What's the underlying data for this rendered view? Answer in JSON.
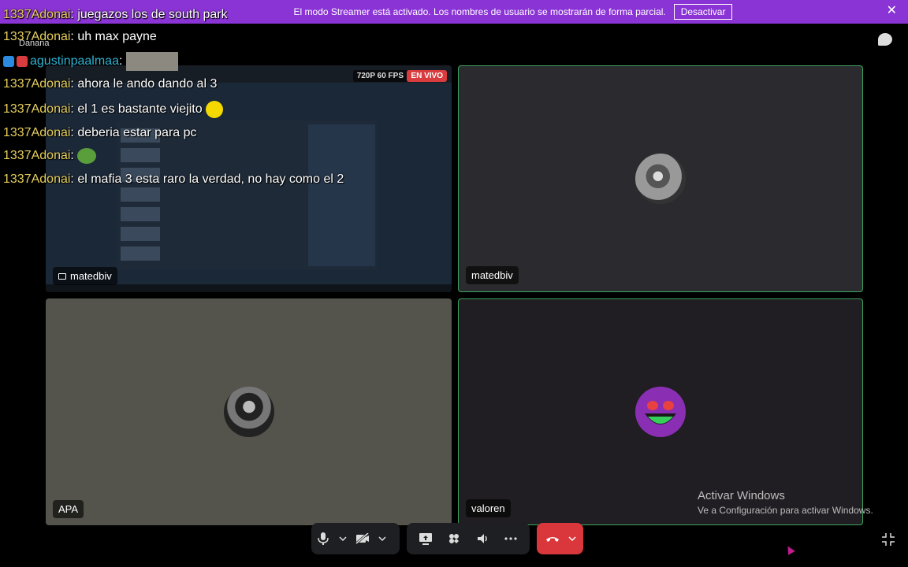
{
  "banner": {
    "message": "El modo Streamer está activado. Los nombres de usuario se mostrarán de forma parcial.",
    "button": "Desactivar",
    "close": "✕"
  },
  "chat": {
    "messages": [
      {
        "user": "1337Adonai",
        "text": ": juegazos los de south park"
      },
      {
        "user": "1337Adonai",
        "text": ": uh max payne"
      },
      {
        "user": "agustinpaalmaa",
        "text": ":"
      },
      {
        "user": "1337Adonai",
        "text": ": ahora le ando dando al 3"
      },
      {
        "user": "1337Adonai",
        "text": ": el 1 es bastante viejito"
      },
      {
        "user": "1337Adonai",
        "text": ": deberia estar para pc"
      },
      {
        "user": "1337Adonai",
        "text": ":"
      },
      {
        "user": "1337Adonai",
        "text": ": el mafia 3 esta raro la verdad, no hay como el 2"
      }
    ],
    "partial_name": "Danana"
  },
  "tiles": [
    {
      "name": "matedbiv",
      "type": "screen-share",
      "quality": "720P 60 FPS",
      "live": "EN VIVO"
    },
    {
      "name": "matedbiv",
      "type": "camera-off"
    },
    {
      "name": "APA",
      "type": "camera-off"
    },
    {
      "name": "valoren",
      "type": "camera-off"
    }
  ],
  "watermark": {
    "title": "Activar Windows",
    "subtitle": "Ve a Configuración para activar Windows."
  },
  "colors": {
    "banner": "#8b34d6",
    "selected_border": "#3ba55c",
    "leave": "#da373c",
    "username": "#e6cf5a"
  }
}
